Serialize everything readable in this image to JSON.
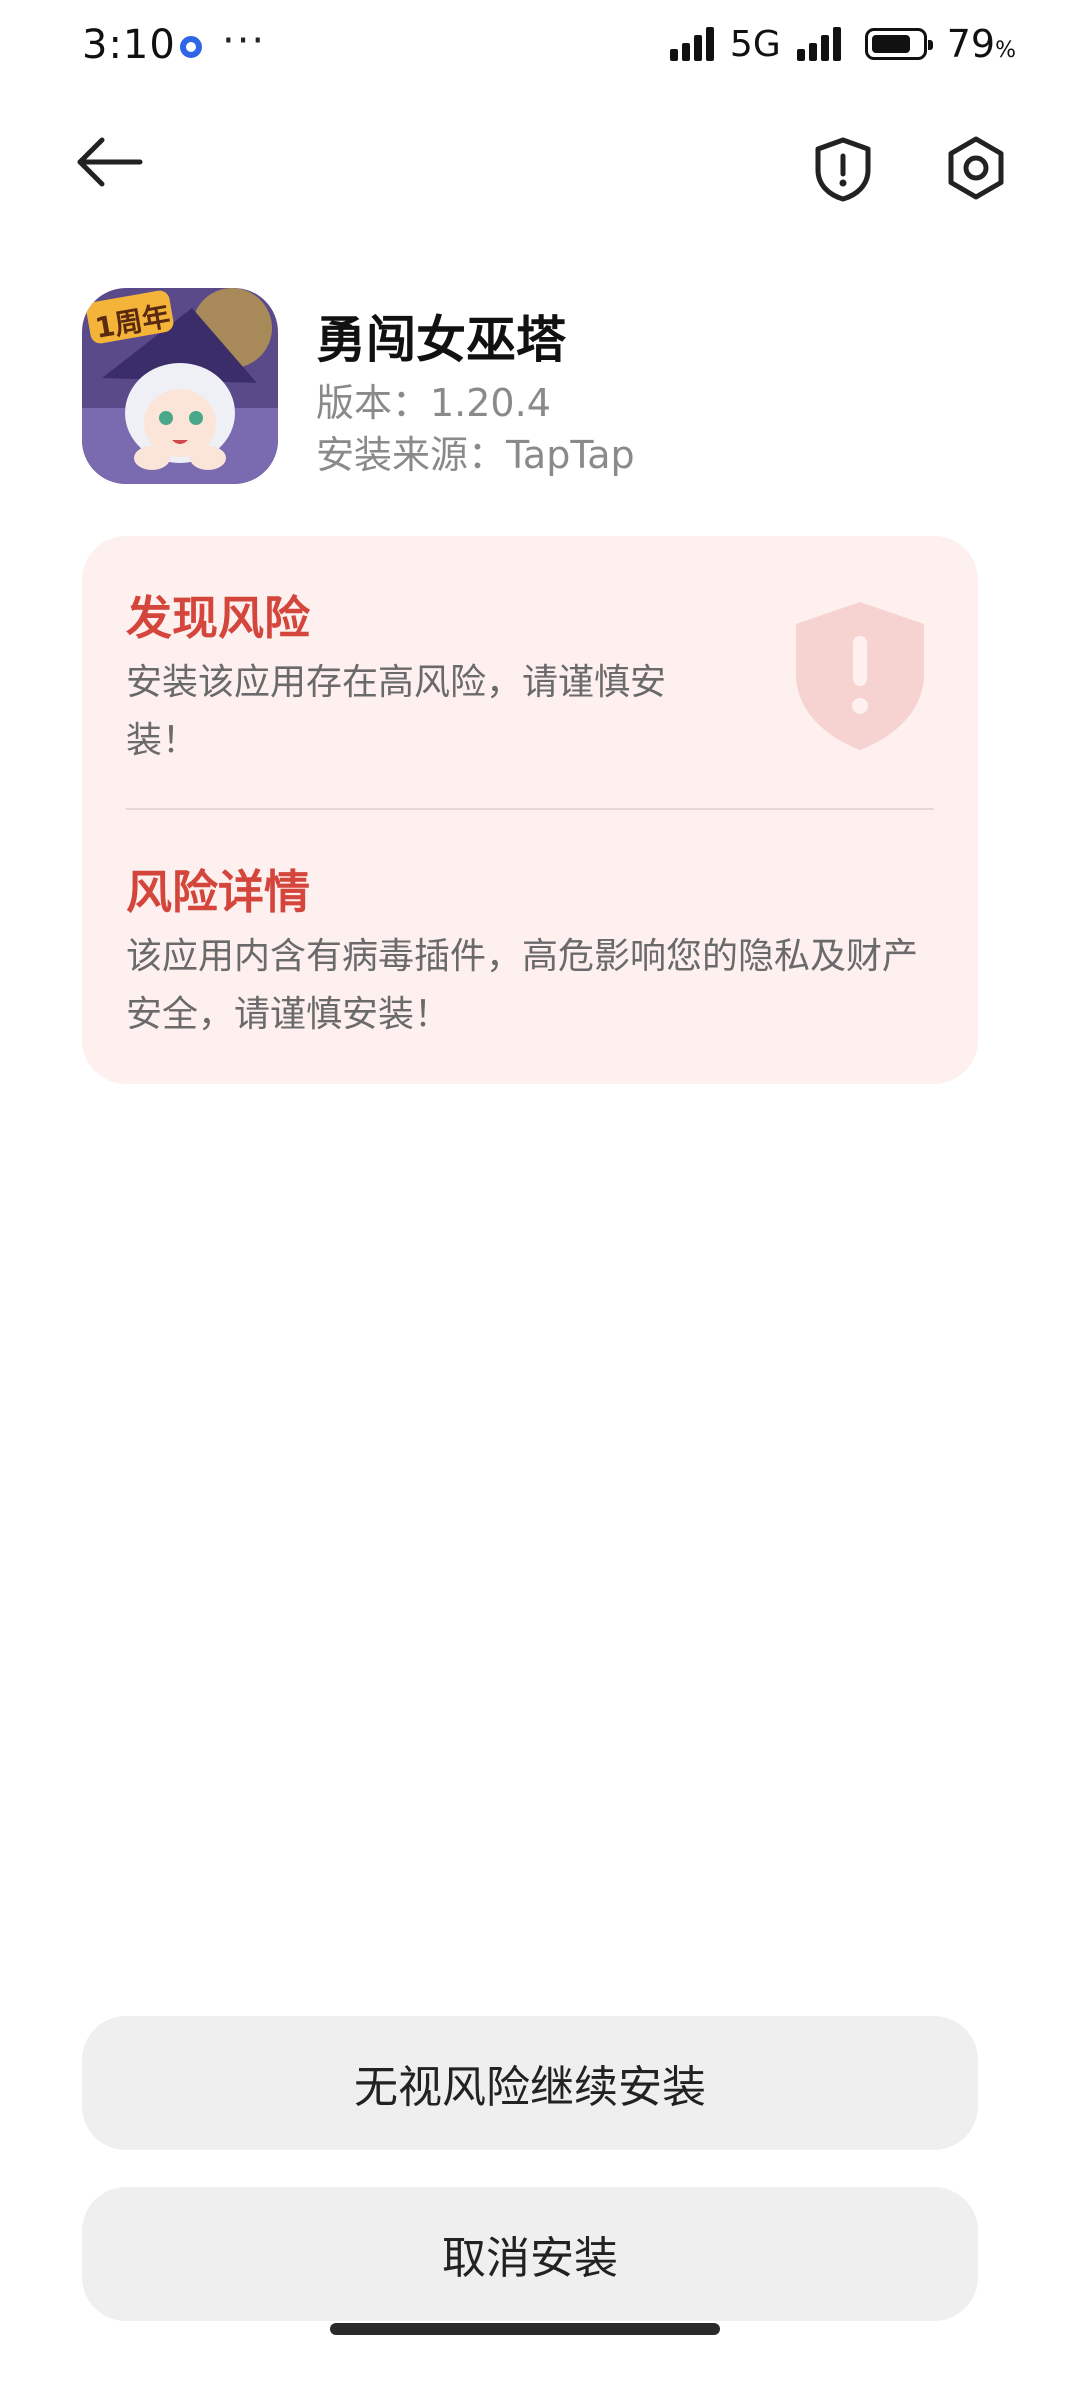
{
  "status_bar": {
    "time": "3:10",
    "more": "···",
    "network": "5G",
    "battery_level": 79,
    "battery_number": "79",
    "battery_percent_sign": "%"
  },
  "toolbar": {
    "back_icon": "arrow-left-icon",
    "security_icon": "shield-alert-icon",
    "settings_icon": "gear-icon"
  },
  "app": {
    "name": "勇闯女巫塔",
    "version": "版本：1.20.4",
    "source": "安装来源：TapTap",
    "icon_badge": "1周年"
  },
  "risk": {
    "title": "发现风险",
    "text": "安装该应用存在高风险，请谨慎安装！",
    "details_title": "风险详情",
    "details_text": "该应用内含有病毒插件，高危影响您的隐私及财产安全，请谨慎安装！",
    "accent_color": "#d4453b",
    "background_color": "#fdf0ef"
  },
  "buttons": {
    "continue": "无视风险继续安装",
    "cancel": "取消安装"
  }
}
